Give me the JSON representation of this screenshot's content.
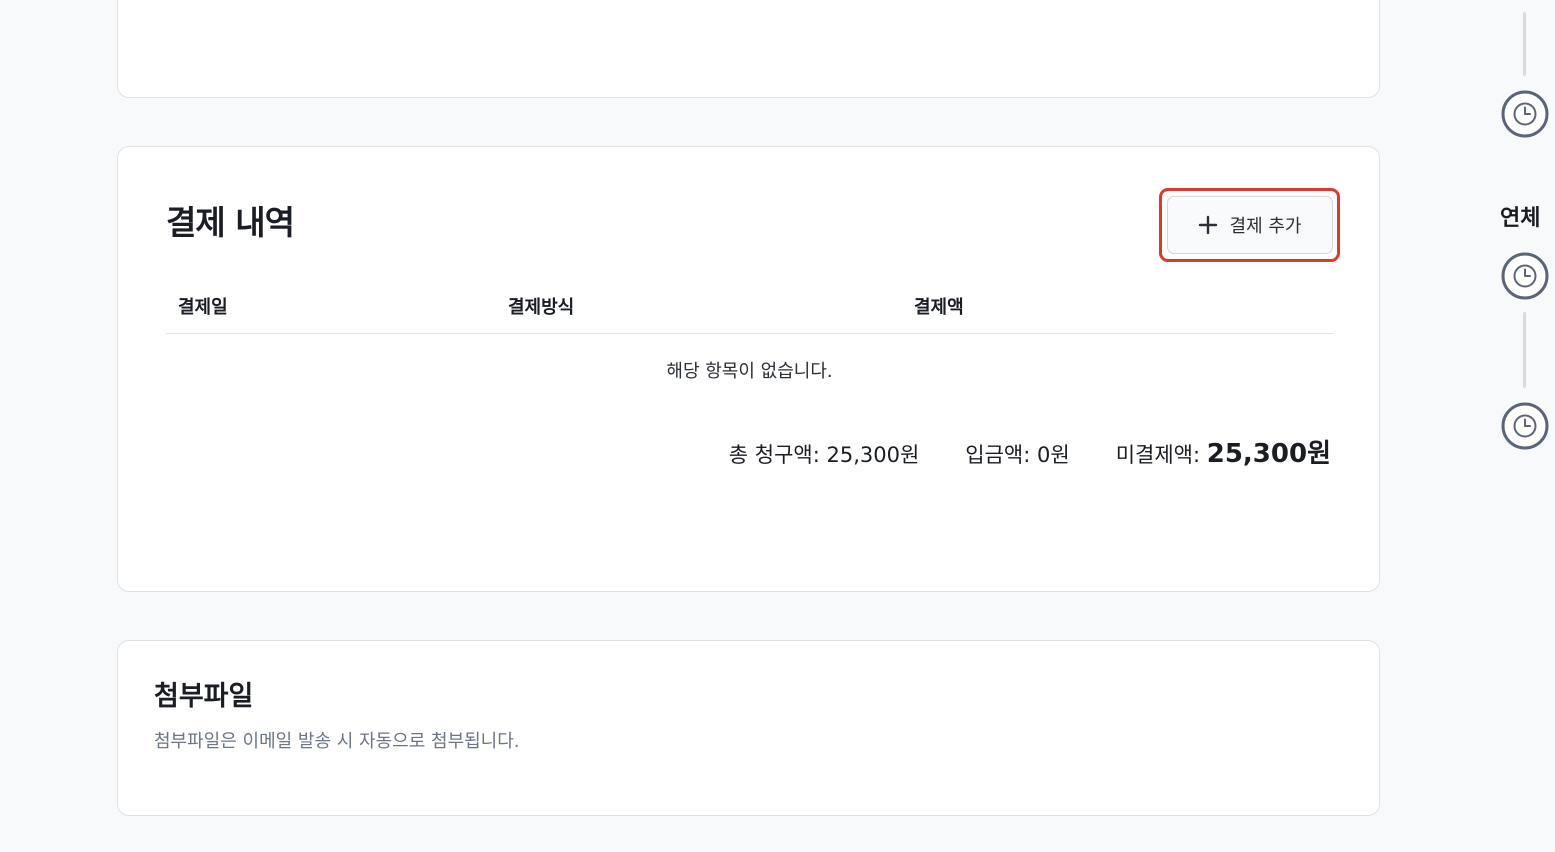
{
  "payment": {
    "title": "결제 내역",
    "add_button_label": "결제 추가",
    "columns": [
      "결제일",
      "결제방식",
      "결제액"
    ],
    "empty_message": "해당 항목이 없습니다.",
    "summary": {
      "total_label": "총 청구액: 25,300원",
      "paid_label": "입금액: 0원",
      "unpaid_prefix": "미결제액:",
      "unpaid_value": "25,300원"
    }
  },
  "attachments": {
    "title": "첨부파일",
    "description": "첨부파일은 이메일 발송 시 자동으로 첨부됩니다."
  },
  "timeline": {
    "overdue_label": "연체",
    "icons": [
      "clock-icon",
      "clock-icon",
      "clock-icon"
    ]
  },
  "colors": {
    "highlight": "#d93a2b",
    "background": "#f8f9fb",
    "muted_text": "#6b7585"
  }
}
